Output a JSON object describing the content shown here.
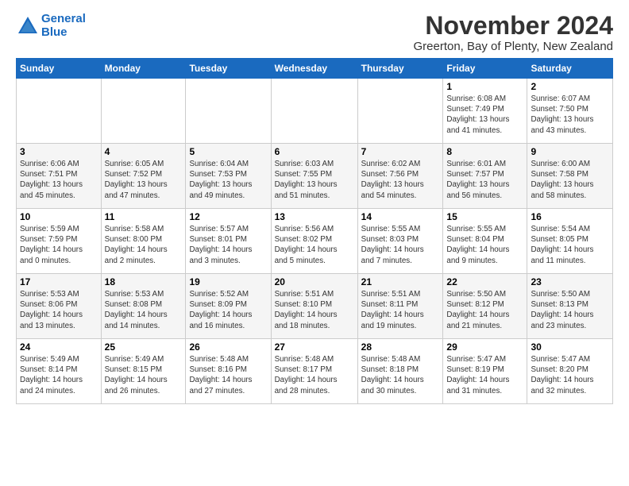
{
  "logo": {
    "line1": "General",
    "line2": "Blue"
  },
  "title": "November 2024",
  "subtitle": "Greerton, Bay of Plenty, New Zealand",
  "days_header": [
    "Sunday",
    "Monday",
    "Tuesday",
    "Wednesday",
    "Thursday",
    "Friday",
    "Saturday"
  ],
  "weeks": [
    [
      {
        "day": "",
        "info": ""
      },
      {
        "day": "",
        "info": ""
      },
      {
        "day": "",
        "info": ""
      },
      {
        "day": "",
        "info": ""
      },
      {
        "day": "",
        "info": ""
      },
      {
        "day": "1",
        "info": "Sunrise: 6:08 AM\nSunset: 7:49 PM\nDaylight: 13 hours\nand 41 minutes."
      },
      {
        "day": "2",
        "info": "Sunrise: 6:07 AM\nSunset: 7:50 PM\nDaylight: 13 hours\nand 43 minutes."
      }
    ],
    [
      {
        "day": "3",
        "info": "Sunrise: 6:06 AM\nSunset: 7:51 PM\nDaylight: 13 hours\nand 45 minutes."
      },
      {
        "day": "4",
        "info": "Sunrise: 6:05 AM\nSunset: 7:52 PM\nDaylight: 13 hours\nand 47 minutes."
      },
      {
        "day": "5",
        "info": "Sunrise: 6:04 AM\nSunset: 7:53 PM\nDaylight: 13 hours\nand 49 minutes."
      },
      {
        "day": "6",
        "info": "Sunrise: 6:03 AM\nSunset: 7:55 PM\nDaylight: 13 hours\nand 51 minutes."
      },
      {
        "day": "7",
        "info": "Sunrise: 6:02 AM\nSunset: 7:56 PM\nDaylight: 13 hours\nand 54 minutes."
      },
      {
        "day": "8",
        "info": "Sunrise: 6:01 AM\nSunset: 7:57 PM\nDaylight: 13 hours\nand 56 minutes."
      },
      {
        "day": "9",
        "info": "Sunrise: 6:00 AM\nSunset: 7:58 PM\nDaylight: 13 hours\nand 58 minutes."
      }
    ],
    [
      {
        "day": "10",
        "info": "Sunrise: 5:59 AM\nSunset: 7:59 PM\nDaylight: 14 hours\nand 0 minutes."
      },
      {
        "day": "11",
        "info": "Sunrise: 5:58 AM\nSunset: 8:00 PM\nDaylight: 14 hours\nand 2 minutes."
      },
      {
        "day": "12",
        "info": "Sunrise: 5:57 AM\nSunset: 8:01 PM\nDaylight: 14 hours\nand 3 minutes."
      },
      {
        "day": "13",
        "info": "Sunrise: 5:56 AM\nSunset: 8:02 PM\nDaylight: 14 hours\nand 5 minutes."
      },
      {
        "day": "14",
        "info": "Sunrise: 5:55 AM\nSunset: 8:03 PM\nDaylight: 14 hours\nand 7 minutes."
      },
      {
        "day": "15",
        "info": "Sunrise: 5:55 AM\nSunset: 8:04 PM\nDaylight: 14 hours\nand 9 minutes."
      },
      {
        "day": "16",
        "info": "Sunrise: 5:54 AM\nSunset: 8:05 PM\nDaylight: 14 hours\nand 11 minutes."
      }
    ],
    [
      {
        "day": "17",
        "info": "Sunrise: 5:53 AM\nSunset: 8:06 PM\nDaylight: 14 hours\nand 13 minutes."
      },
      {
        "day": "18",
        "info": "Sunrise: 5:53 AM\nSunset: 8:08 PM\nDaylight: 14 hours\nand 14 minutes."
      },
      {
        "day": "19",
        "info": "Sunrise: 5:52 AM\nSunset: 8:09 PM\nDaylight: 14 hours\nand 16 minutes."
      },
      {
        "day": "20",
        "info": "Sunrise: 5:51 AM\nSunset: 8:10 PM\nDaylight: 14 hours\nand 18 minutes."
      },
      {
        "day": "21",
        "info": "Sunrise: 5:51 AM\nSunset: 8:11 PM\nDaylight: 14 hours\nand 19 minutes."
      },
      {
        "day": "22",
        "info": "Sunrise: 5:50 AM\nSunset: 8:12 PM\nDaylight: 14 hours\nand 21 minutes."
      },
      {
        "day": "23",
        "info": "Sunrise: 5:50 AM\nSunset: 8:13 PM\nDaylight: 14 hours\nand 23 minutes."
      }
    ],
    [
      {
        "day": "24",
        "info": "Sunrise: 5:49 AM\nSunset: 8:14 PM\nDaylight: 14 hours\nand 24 minutes."
      },
      {
        "day": "25",
        "info": "Sunrise: 5:49 AM\nSunset: 8:15 PM\nDaylight: 14 hours\nand 26 minutes."
      },
      {
        "day": "26",
        "info": "Sunrise: 5:48 AM\nSunset: 8:16 PM\nDaylight: 14 hours\nand 27 minutes."
      },
      {
        "day": "27",
        "info": "Sunrise: 5:48 AM\nSunset: 8:17 PM\nDaylight: 14 hours\nand 28 minutes."
      },
      {
        "day": "28",
        "info": "Sunrise: 5:48 AM\nSunset: 8:18 PM\nDaylight: 14 hours\nand 30 minutes."
      },
      {
        "day": "29",
        "info": "Sunrise: 5:47 AM\nSunset: 8:19 PM\nDaylight: 14 hours\nand 31 minutes."
      },
      {
        "day": "30",
        "info": "Sunrise: 5:47 AM\nSunset: 8:20 PM\nDaylight: 14 hours\nand 32 minutes."
      }
    ]
  ]
}
